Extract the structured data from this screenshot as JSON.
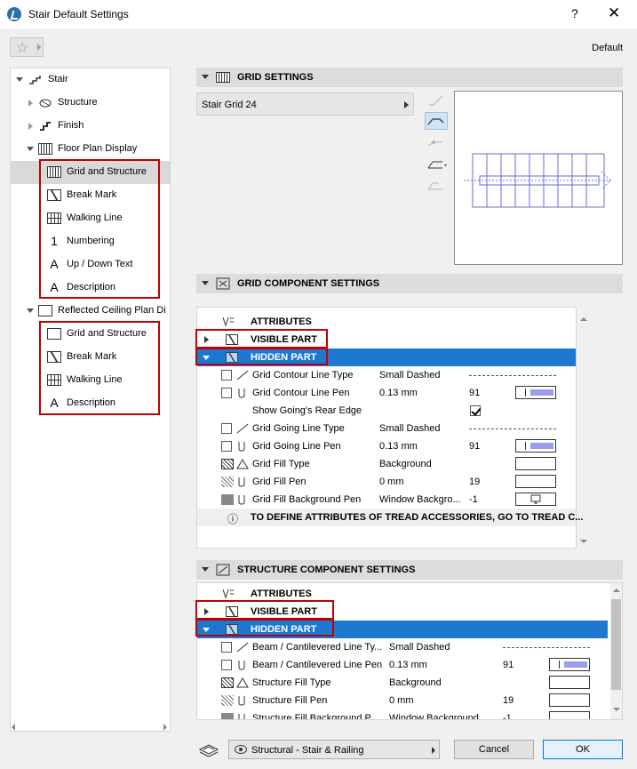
{
  "window": {
    "title": "Stair Default Settings",
    "help": "?",
    "close": "✕"
  },
  "header": {
    "default_label": "Default"
  },
  "tree": {
    "root": "Stair",
    "structure": "Structure",
    "finish": "Finish",
    "floor_plan": "Floor Plan Display",
    "floor_children": [
      "Grid and Structure",
      "Break Mark",
      "Walking Line",
      "Numbering",
      "Up / Down Text",
      "Description"
    ],
    "rcp": "Reflected Ceiling Plan Di",
    "rcp_children": [
      "Grid and Structure",
      "Break Mark",
      "Walking Line",
      "Description"
    ]
  },
  "grid_settings": {
    "title": "GRID SETTINGS",
    "selected": "Stair Grid 24"
  },
  "grid_component": {
    "title": "GRID COMPONENT SETTINGS",
    "attributes": "ATTRIBUTES",
    "visible": "VISIBLE PART",
    "hidden": "HIDDEN PART",
    "rows": [
      {
        "name": "Grid Contour Line Type",
        "value": "Small Dashed",
        "num": ""
      },
      {
        "name": "Grid Contour Line Pen",
        "value": "0.13 mm",
        "num": "91"
      },
      {
        "name": "Show Going's Rear Edge",
        "value": "",
        "num": ""
      },
      {
        "name": "Grid Going Line Type",
        "value": "Small Dashed",
        "num": ""
      },
      {
        "name": "Grid Going Line Pen",
        "value": "0.13 mm",
        "num": "91"
      },
      {
        "name": "Grid Fill Type",
        "value": "Background",
        "num": ""
      },
      {
        "name": "Grid Fill Pen",
        "value": "0 mm",
        "num": "19"
      },
      {
        "name": "Grid Fill Background Pen",
        "value": "Window Backgro...",
        "num": "-1"
      }
    ],
    "info": "TO DEFINE ATTRIBUTES OF TREAD ACCESSORIES, GO TO TREAD C..."
  },
  "structure_component": {
    "title": "STRUCTURE COMPONENT SETTINGS",
    "attributes": "ATTRIBUTES",
    "visible": "VISIBLE PART",
    "hidden": "HIDDEN PART",
    "rows": [
      {
        "name": "Beam / Cantilevered Line Ty...",
        "value": "Small Dashed",
        "num": ""
      },
      {
        "name": "Beam / Cantilevered Line Pen",
        "value": "0.13 mm",
        "num": "91"
      },
      {
        "name": "Structure Fill Type",
        "value": "Background",
        "num": ""
      },
      {
        "name": "Structure Fill Pen",
        "value": "0 mm",
        "num": "19"
      },
      {
        "name": "Structure Fill Background P...",
        "value": "Window Background",
        "num": "-1"
      }
    ]
  },
  "footer": {
    "favorite": "Structural - Stair & Railing",
    "cancel": "Cancel",
    "ok": "OK"
  }
}
